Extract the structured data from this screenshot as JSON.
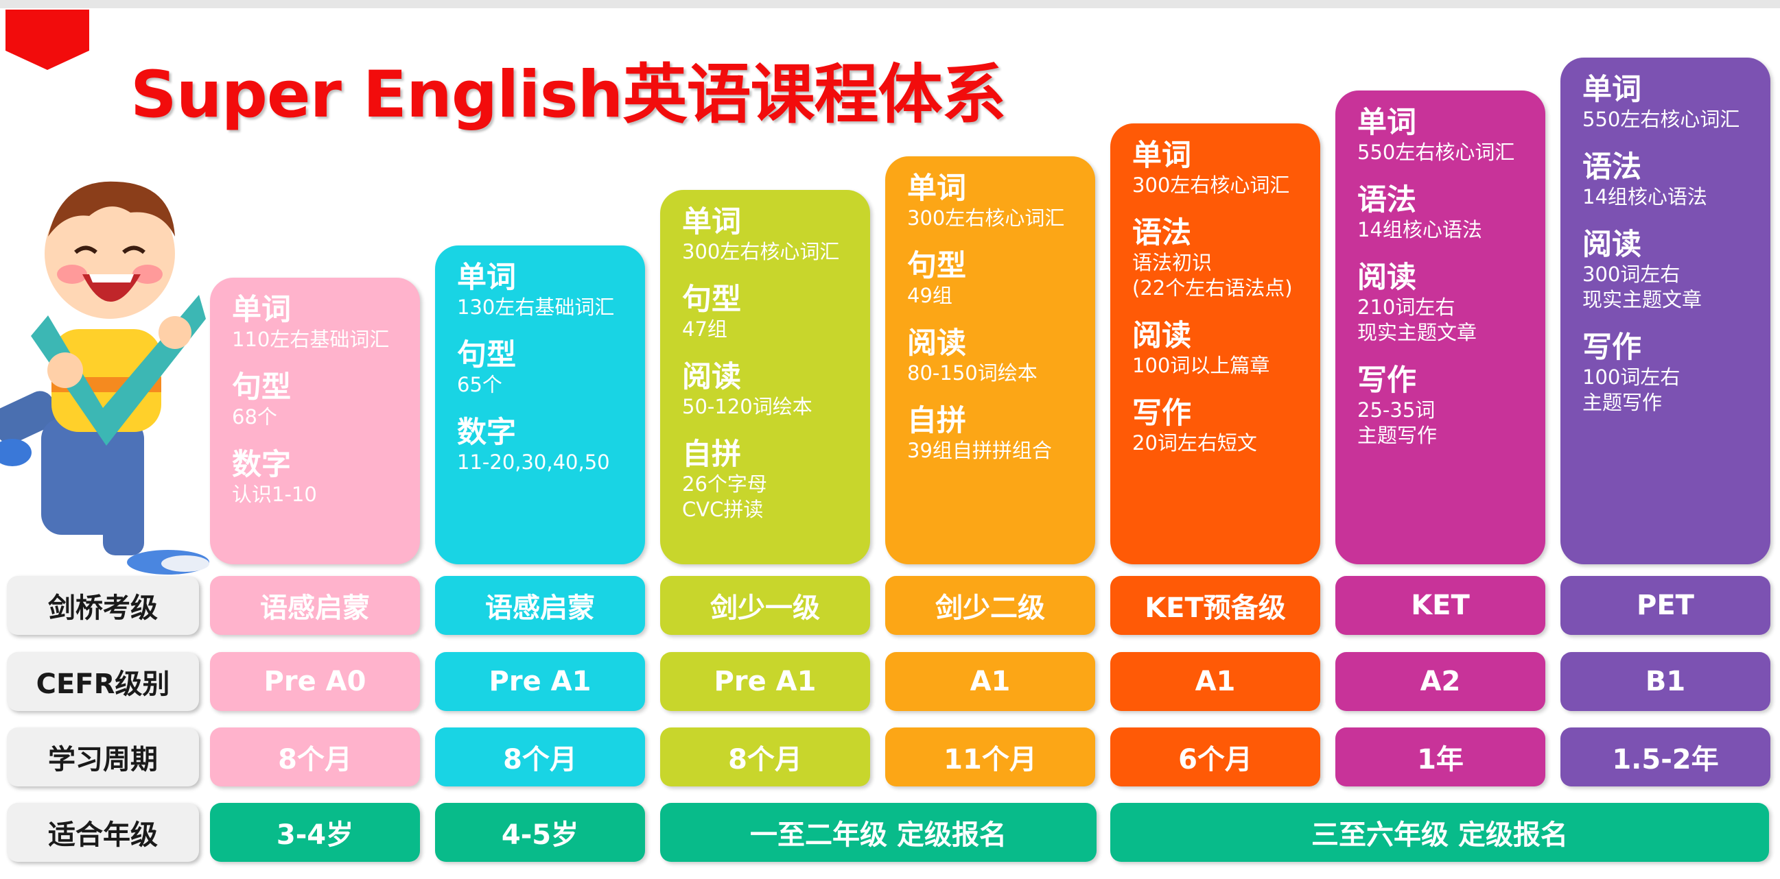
{
  "title": "Super English英语课程体系",
  "colors": {
    "pink": "#ffb3cc",
    "cyan": "#19d4e4",
    "lime": "#c8d62c",
    "amber": "#fca616",
    "orange": "#ff5a06",
    "magenta": "#c83399",
    "purple": "#7c52b2",
    "green": "#08bb8a"
  },
  "levels": [
    {
      "sections": [
        {
          "h": "单词",
          "lines": [
            "110左右基础词汇"
          ]
        },
        {
          "h": "句型",
          "lines": [
            "68个"
          ]
        },
        {
          "h": "数字",
          "lines": [
            "认识1-10"
          ]
        }
      ],
      "exam": "语感启蒙",
      "cefr": "Pre A0",
      "period": "8个月"
    },
    {
      "sections": [
        {
          "h": "单词",
          "lines": [
            "130左右基础词汇"
          ]
        },
        {
          "h": "句型",
          "lines": [
            "65个"
          ]
        },
        {
          "h": "数字",
          "lines": [
            "11-20,30,40,50"
          ]
        }
      ],
      "exam": "语感启蒙",
      "cefr": "Pre A1",
      "period": "8个月"
    },
    {
      "sections": [
        {
          "h": "单词",
          "lines": [
            "300左右核心词汇"
          ]
        },
        {
          "h": "句型",
          "lines": [
            "47组"
          ]
        },
        {
          "h": "阅读",
          "lines": [
            "50-120词绘本"
          ]
        },
        {
          "h": "自拼",
          "lines": [
            "26个字母",
            "CVC拼读"
          ]
        }
      ],
      "exam": "剑少一级",
      "cefr": "Pre A1",
      "period": "8个月"
    },
    {
      "sections": [
        {
          "h": "单词",
          "lines": [
            "300左右核心词汇"
          ]
        },
        {
          "h": "句型",
          "lines": [
            "49组"
          ]
        },
        {
          "h": "阅读",
          "lines": [
            "80-150词绘本"
          ]
        },
        {
          "h": "自拼",
          "lines": [
            "39组自拼拼组合"
          ]
        }
      ],
      "exam": "剑少二级",
      "cefr": "A1",
      "period": "11个月"
    },
    {
      "sections": [
        {
          "h": "单词",
          "lines": [
            "300左右核心词汇"
          ]
        },
        {
          "h": "语法",
          "lines": [
            "语法初识",
            "(22个左右语法点)"
          ]
        },
        {
          "h": "阅读",
          "lines": [
            "100词以上篇章"
          ]
        },
        {
          "h": "写作",
          "lines": [
            "20词左右短文"
          ]
        }
      ],
      "exam": "KET预备级",
      "cefr": "A1",
      "period": "6个月"
    },
    {
      "sections": [
        {
          "h": "单词",
          "lines": [
            "550左右核心词汇"
          ]
        },
        {
          "h": "语法",
          "lines": [
            "14组核心语法"
          ]
        },
        {
          "h": "阅读",
          "lines": [
            "210词左右",
            "现实主题文章"
          ]
        },
        {
          "h": "写作",
          "lines": [
            "25-35词",
            "主题写作"
          ]
        }
      ],
      "exam": "KET",
      "cefr": "A2",
      "period": "1年"
    },
    {
      "sections": [
        {
          "h": "单词",
          "lines": [
            "550左右核心词汇"
          ]
        },
        {
          "h": "语法",
          "lines": [
            "14组核心语法"
          ]
        },
        {
          "h": "阅读",
          "lines": [
            "300词左右",
            "现实主题文章"
          ]
        },
        {
          "h": "写作",
          "lines": [
            "100词左右",
            "主题写作"
          ]
        }
      ],
      "exam": "PET",
      "cefr": "B1",
      "period": "1.5-2年"
    }
  ],
  "row_labels": {
    "exam": "剑桥考级",
    "cefr": "CEFR级别",
    "period": "学习周期",
    "age": "适合年级"
  },
  "ages": [
    "3-4岁",
    "4-5岁",
    "一至二年级 定级报名",
    "三至六年级 定级报名"
  ]
}
